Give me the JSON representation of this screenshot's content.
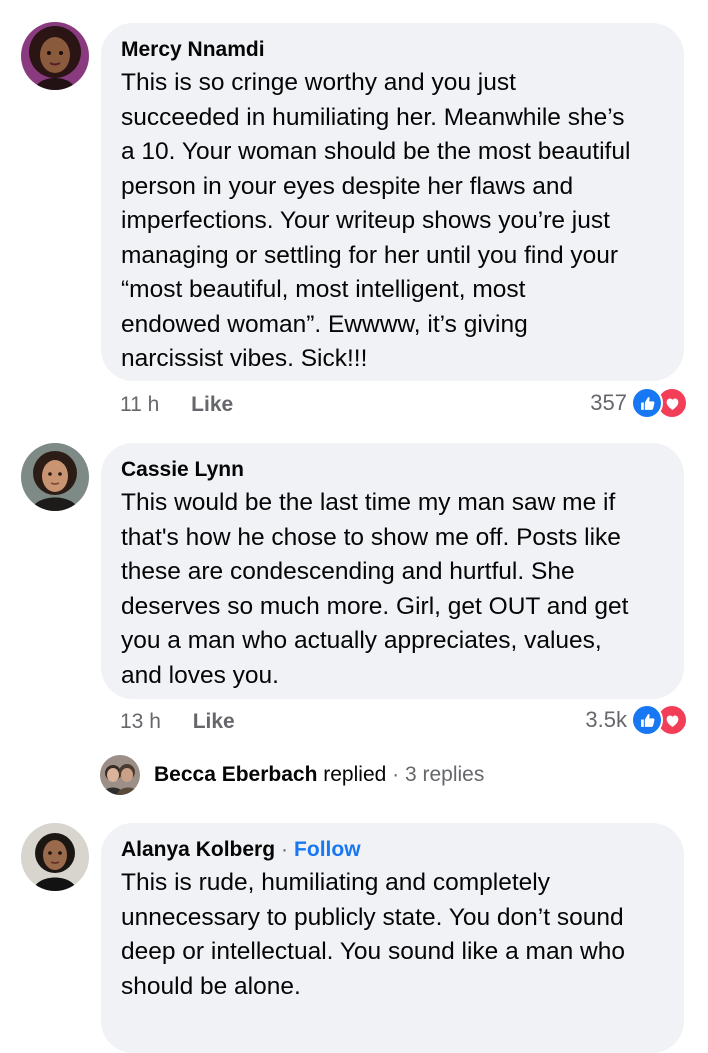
{
  "comments": [
    {
      "author": "Mercy Nnamdi",
      "text_lines": [
        "This is so cringe worthy and you just",
        "succeeded in humiliating her. Meanwhile she’s",
        "a 10. Your woman should be the most beautiful",
        "person in your eyes despite her flaws and",
        "imperfections. Your writeup shows you’re just",
        "managing or settling for her until you find your",
        "“most beautiful, most intelligent, most",
        "endowed woman”. Ewwww, it’s giving",
        "narcissist vibes. Sick!!!"
      ],
      "time": "11 h",
      "like_label": "Like",
      "reaction_count": "357"
    },
    {
      "author": "Cassie Lynn",
      "text_lines": [
        "This would be the last time my man saw me if",
        "that's how he chose to show me off. Posts like",
        "these are condescending and hurtful. She",
        "deserves so much more. Girl, get OUT and get",
        "you a man who actually appreciates, values,",
        "and loves you."
      ],
      "time": "13 h",
      "like_label": "Like",
      "reaction_count": "3.5k",
      "replies": {
        "name": "Becca Eberbach",
        "action": " replied",
        "separator": " · ",
        "count": "3 replies"
      }
    },
    {
      "author": "Alanya Kolberg",
      "follow_separator": "·",
      "follow_label": "Follow",
      "text_lines": [
        "This is rude, humiliating and completely",
        "unnecessary to publicly state. You don’t sound",
        "deep or intellectual. You sound like a man who",
        "should be alone."
      ]
    }
  ],
  "colors": {
    "bubble": "#f0f2f5",
    "secondary_text": "#65676b",
    "link": "#1877f2",
    "like_reaction": "#1877f2",
    "love_reaction": "#f33e58"
  },
  "icons": [
    "like-reaction-icon",
    "love-reaction-icon"
  ]
}
